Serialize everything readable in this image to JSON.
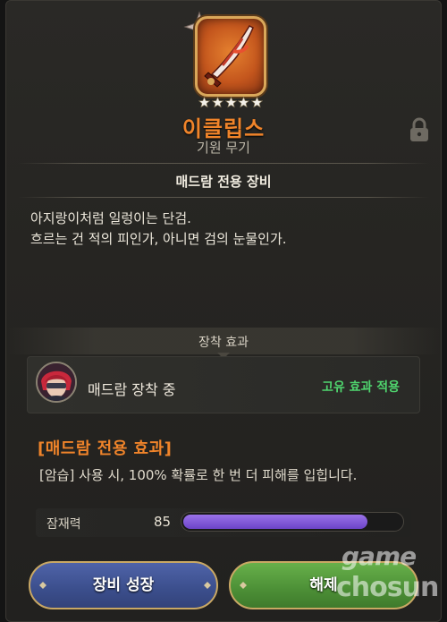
{
  "weapon": {
    "name": "이클립스",
    "type": "기원 무기",
    "stars": 5,
    "icon": "dagger-icon"
  },
  "owner_title": "매드람  전용 장비",
  "description": [
    "아지랑이처럼 일렁이는 단검.",
    "흐르는 건 적의 피인가, 아니면 검의 눈물인가."
  ],
  "section_title": "장착 효과",
  "equip": {
    "label": "매드람 장착 중",
    "status": "고유 효과 적용",
    "avatar": "character-avatar"
  },
  "exclusive": {
    "title": "[매드람 전용 효과]",
    "desc": "[암습] 사용 시, 100% 확률로 한 번 더 피해를 입힙니다."
  },
  "potential": {
    "label": "잠재력",
    "value": "85",
    "fill_fraction": 0.85
  },
  "buttons": {
    "grow": "장비 성장",
    "unequip": "해제"
  },
  "watermark": {
    "line1": "game",
    "line2": "chosun"
  },
  "colors": {
    "accent_orange": "#f0842a",
    "status_green": "#4fd46e",
    "bar_purple": "#8a5fe0"
  }
}
